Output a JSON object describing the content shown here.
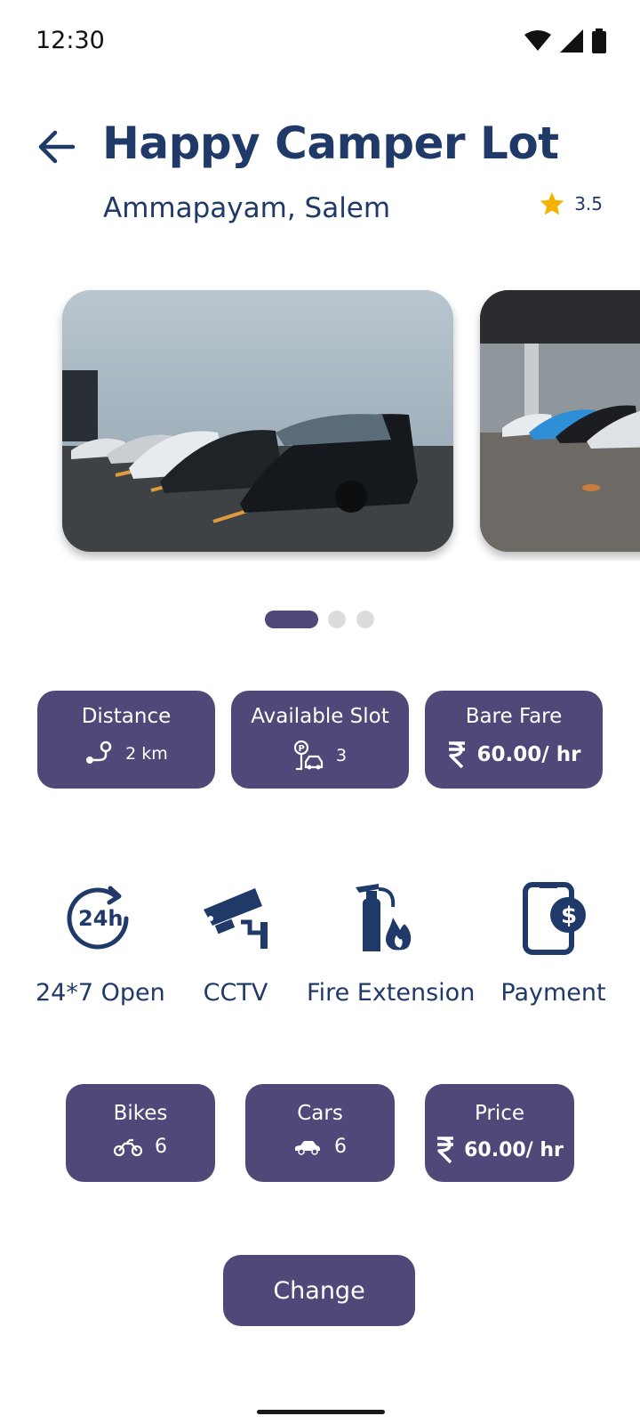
{
  "status_bar": {
    "time": "12:30",
    "icons": [
      "wifi-icon",
      "signal-icon",
      "battery-icon"
    ]
  },
  "header": {
    "title": "Happy Camper Lot",
    "subtitle": "Ammapayam, Salem",
    "rating": "3.5"
  },
  "carousel": {
    "slide_count": 3,
    "active_index": 0
  },
  "info_cards": [
    {
      "label": "Distance",
      "icon": "route-pin-icon",
      "value": "2 km"
    },
    {
      "label": "Available Slot",
      "icon": "parking-car-icon",
      "value": "3"
    },
    {
      "label": "Bare Fare",
      "icon": "rupee-icon",
      "value": "60.00/ hr"
    }
  ],
  "amenities": [
    {
      "label": "24*7 Open",
      "icon": "24h-clock-icon"
    },
    {
      "label": "CCTV",
      "icon": "cctv-camera-icon"
    },
    {
      "label": "Fire Extension",
      "icon": "fire-extinguisher-icon"
    },
    {
      "label": "Payment",
      "icon": "mobile-payment-icon"
    }
  ],
  "vehicle_cards": [
    {
      "label": "Bikes",
      "icon": "motorbike-icon",
      "value": "6"
    },
    {
      "label": "Cars",
      "icon": "car-icon",
      "value": "6"
    },
    {
      "label": "Price",
      "icon": "rupee-icon",
      "value": "60.00/ hr"
    }
  ],
  "change_button": "Change",
  "colors": {
    "primary": "#4f4979",
    "text": "#1f3a68",
    "star": "#f5b301",
    "dot_inactive": "#dcdcdc"
  }
}
